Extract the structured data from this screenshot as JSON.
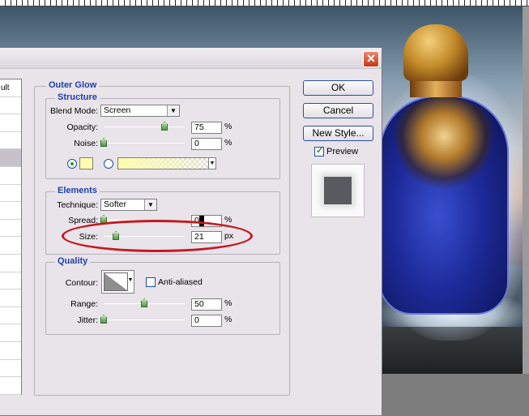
{
  "dialog": {
    "close_glyph": "✕",
    "styles_list": {
      "rows": [
        "ult",
        "",
        "",
        "",
        "",
        "",
        "",
        "",
        "",
        "",
        "",
        "",
        "",
        "",
        "",
        "",
        "",
        ""
      ],
      "selected_index": 4
    }
  },
  "outer_glow": {
    "title": "Outer Glow",
    "structure": {
      "title": "Structure",
      "blend_mode_label": "Blend Mode:",
      "blend_mode_value": "Screen",
      "opacity_label": "Opacity:",
      "opacity_value": "75",
      "opacity_unit": "%",
      "opacity_level": 0.75,
      "noise_label": "Noise:",
      "noise_value": "0",
      "noise_unit": "%",
      "noise_level": 0,
      "glow_color": "#fffbb0"
    },
    "elements": {
      "title": "Elements",
      "technique_label": "Technique:",
      "technique_value": "Softer",
      "spread_label": "Spread:",
      "spread_value": "0",
      "spread_unit": "%",
      "spread_level": 0,
      "size_label": "Size:",
      "size_value": "21",
      "size_unit": "px",
      "size_level": 0.15
    },
    "quality": {
      "title": "Quality",
      "contour_label": "Contour:",
      "anti_aliased_label": "Anti-aliased",
      "anti_aliased_checked": false,
      "range_label": "Range:",
      "range_value": "50",
      "range_unit": "%",
      "range_level": 0.5,
      "jitter_label": "Jitter:",
      "jitter_value": "0",
      "jitter_unit": "%",
      "jitter_level": 0
    }
  },
  "buttons": {
    "ok": "OK",
    "cancel": "Cancel",
    "new_style": "New Style...",
    "preview_label": "Preview",
    "preview_checked": true
  },
  "colors": {
    "group_title": "#1f3fa8",
    "highlight_ellipse": "#c41920"
  }
}
